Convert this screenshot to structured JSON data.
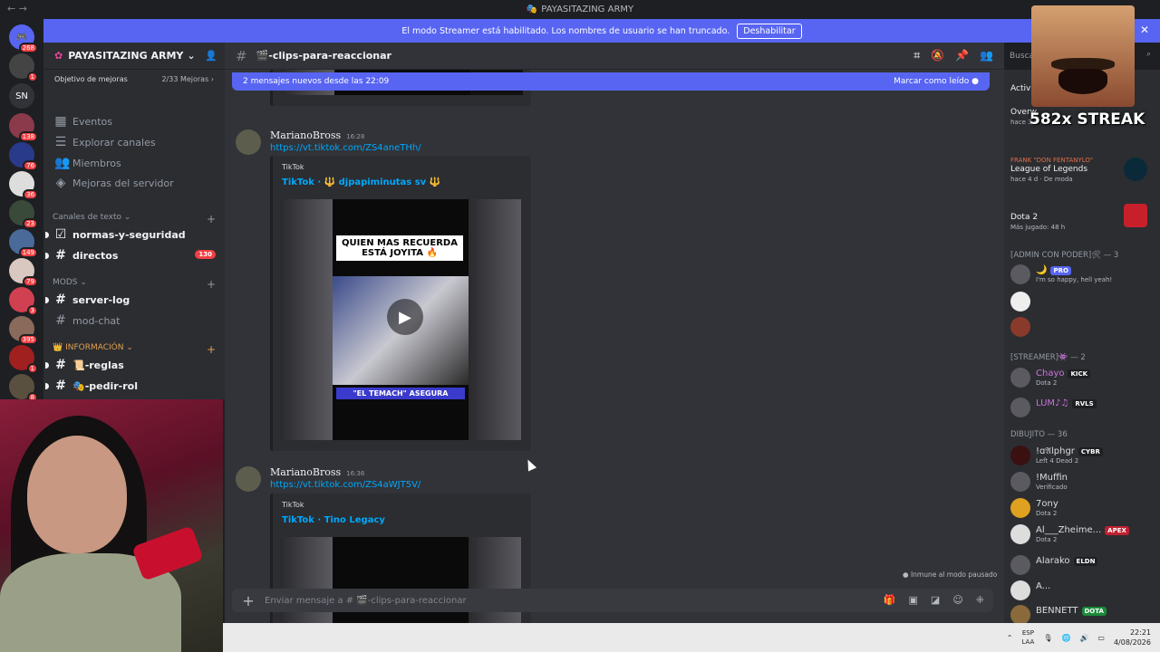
{
  "window": {
    "title": "PAYASITAZING ARMY",
    "nav": "←  →"
  },
  "banner": {
    "text": "El modo Streamer está habilitado. Los nombres de usuario se han truncado.",
    "button": "Deshabilitar",
    "close": "✕"
  },
  "guilds": [
    {
      "label": "",
      "badge": "268"
    },
    {
      "label": "",
      "badge": "1"
    },
    {
      "label": "SN",
      "badge": ""
    },
    {
      "label": "",
      "badge": "138"
    },
    {
      "label": "",
      "badge": "76"
    },
    {
      "label": "",
      "badge": "36"
    },
    {
      "label": "",
      "badge": "23"
    },
    {
      "label": "",
      "badge": "149"
    },
    {
      "label": "",
      "badge": "79"
    },
    {
      "label": "",
      "badge": "3"
    },
    {
      "label": "",
      "badge": "395"
    },
    {
      "label": "",
      "badge": "1"
    },
    {
      "label": "",
      "badge": "8"
    }
  ],
  "sidebar": {
    "server_name": "PAYASITAZING ARMY",
    "boost_label": "Objetivo de mejoras",
    "boost_count": "2/33 Mejoras",
    "items": [
      "Eventos",
      "Explorar canales",
      "Miembros",
      "Mejoras del servidor"
    ],
    "categories": {
      "text": "Canales de texto",
      "mods": "MODS",
      "info": "INFORMACIÓN"
    },
    "channels": [
      {
        "name": "normas-y-seguridad",
        "count": ""
      },
      {
        "name": "directos",
        "count": "130"
      },
      {
        "name": "server-log",
        "count": ""
      },
      {
        "name": "mod-chat",
        "count": ""
      },
      {
        "name": "📜-reglas",
        "count": ""
      },
      {
        "name": "🎭-pedir-rol",
        "count": ""
      }
    ]
  },
  "channel_header": {
    "name": "🎬-clips-para-reaccionar",
    "search_placeholder": "Busca"
  },
  "new_messages": {
    "text": "2 mensajes nuevos desde las 22:09",
    "action": "Marcar como leído"
  },
  "messages": [
    {
      "user": "MarianoBross",
      "time": "16:28",
      "link": "https://vt.tiktok.com/ZS4aneTHh/",
      "provider": "TikTok",
      "title": "TikTok · 🔱 djpapiminutas sv 🔱",
      "video_caption": "QUIEN MAS RECUERDA ESTÁ JOYITA 🔥",
      "video_banner": "\"EL TEMACH\" ASEGURA"
    },
    {
      "user": "MarianoBross",
      "time": "16:36",
      "link": "https://vt.tiktok.com/ZS4aWJT5V/",
      "provider": "TikTok",
      "title": "TikTok · Tino Legacy"
    }
  ],
  "composer": {
    "placeholder": "Enviar mensaje a # 🎬-clips-para-reaccionar",
    "paused": "Inmune al modo pausado"
  },
  "members": {
    "activity_label": "Activi",
    "activities": [
      {
        "game": "Overw",
        "meta": "hace 3 d"
      },
      {
        "user": "FRANK \"DON FENTANYLO\"",
        "game": "League of Legends",
        "meta": "hace 4 d",
        "trend": "De moda"
      },
      {
        "game": "Dota 2",
        "meta": "Más jugado: 48 h"
      }
    ],
    "groups": [
      {
        "title": "[ADMIN CON PODER]🛠 — 3",
        "members": [
          {
            "name": "🌙",
            "status": "I'm so happy, hell yeah!",
            "tag": "PRO"
          },
          {
            "name": "",
            "status": "",
            "tag": ""
          },
          {
            "name": "",
            "status": "",
            "tag": ""
          }
        ]
      },
      {
        "title": "[STREAMER]👾 — 2",
        "members": [
          {
            "name": "Chayo",
            "status": "Dota 2",
            "tag": "KICK"
          },
          {
            "name": "LUM♪♫",
            "status": "",
            "tag": "RVLS"
          }
        ]
      },
      {
        "title": "DIBUJITO — 36",
        "members": [
          {
            "name": "!ɑ𝔄lphgr",
            "status": "Left 4 Dead 2",
            "tag": "CYBR"
          },
          {
            "name": "!Muffin",
            "status": "Verificado",
            "tag": ""
          },
          {
            "name": "7ony",
            "status": "Dota 2",
            "tag": ""
          },
          {
            "name": "Al___Zheime...",
            "status": "Dota 2",
            "tag": "APEX"
          },
          {
            "name": "Alarako",
            "status": "",
            "tag": "ELDN"
          },
          {
            "name": "A...",
            "status": "",
            "tag": ""
          },
          {
            "name": "BENNETT",
            "status": "",
            "tag": "DOTA"
          }
        ]
      }
    ]
  },
  "overlay": {
    "stream_text": "582x STREAK"
  },
  "taskbar": {
    "lang1": "ESP",
    "lang2": "LAA",
    "time": "22:21",
    "date": "4/08/2026"
  },
  "colors": {
    "accent": "#5865f2",
    "link": "#00a8fc",
    "badge": "#f23f43",
    "bg": "#313338"
  }
}
